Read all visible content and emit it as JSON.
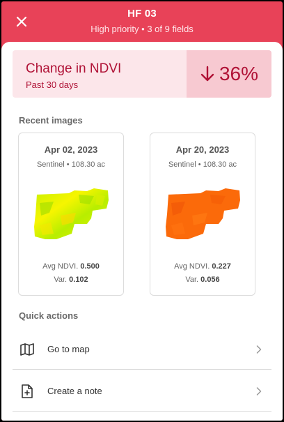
{
  "header": {
    "title": "HF 03",
    "subtitle": "High priority • 3 of 9 fields"
  },
  "ndvi": {
    "title": "Change in NDVI",
    "period": "Past 30 days",
    "change": "36%",
    "direction": "down",
    "accent_color": "#b01236"
  },
  "recent_images": {
    "heading": "Recent images",
    "cards": [
      {
        "date": "Apr 02, 2023",
        "source": "Sentinel",
        "area": "108.30 ac",
        "avg_label": "Avg NDVI.",
        "avg_value": "0.500",
        "var_label": "Var.",
        "var_value": "0.102",
        "map_palette": "yellow-green"
      },
      {
        "date": "Apr 20, 2023",
        "source": "Sentinel",
        "area": "108.30 ac",
        "avg_label": "Avg NDVI.",
        "avg_value": "0.227",
        "var_label": "Var.",
        "var_value": "0.056",
        "map_palette": "orange"
      }
    ]
  },
  "quick_actions": {
    "heading": "Quick actions",
    "items": [
      {
        "label": "Go to map",
        "icon": "map-icon"
      },
      {
        "label": "Create a note",
        "icon": "note-add-icon"
      }
    ]
  },
  "colors": {
    "brand": "#e84258",
    "card_bg": "#fce6ea",
    "delta_bg": "#f7c9d1"
  }
}
